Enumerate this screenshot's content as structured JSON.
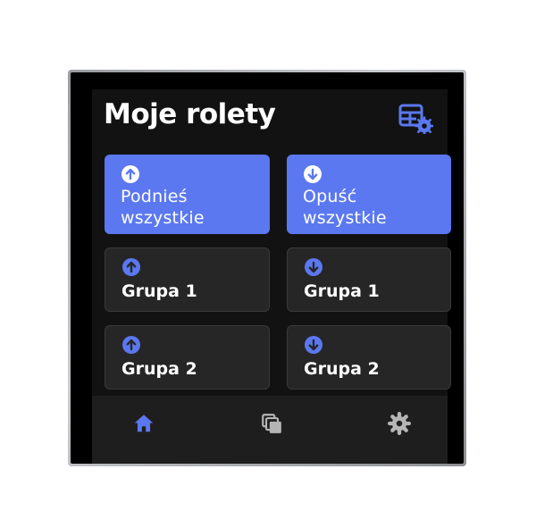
{
  "header": {
    "title": "Moje rolety",
    "settings_icon": "grid-settings-icon"
  },
  "colors": {
    "accent": "#5b78f0",
    "screen_background": "#121212",
    "tile_background": "#262626",
    "nav_background": "#1e1e1e",
    "inactive_icon": "#b5b5b5"
  },
  "tiles": [
    {
      "label_line1": "Podnieś",
      "label_line2": "wszystkie",
      "icon": "arrow-up-circle-icon",
      "style": "primary"
    },
    {
      "label_line1": "Opuść",
      "label_line2": "wszystkie",
      "icon": "arrow-down-circle-icon",
      "style": "primary"
    },
    {
      "label": "Grupa 1",
      "icon": "arrow-up-circle-icon",
      "style": "secondary"
    },
    {
      "label": "Grupa 1",
      "icon": "arrow-down-circle-icon",
      "style": "secondary"
    },
    {
      "label": "Grupa 2",
      "icon": "arrow-up-circle-icon",
      "style": "secondary"
    },
    {
      "label": "Grupa 2",
      "icon": "arrow-down-circle-icon",
      "style": "secondary"
    }
  ],
  "nav": {
    "items": [
      {
        "icon": "home-icon",
        "active": true
      },
      {
        "icon": "layers-icon",
        "active": false
      },
      {
        "icon": "gear-icon",
        "active": false
      }
    ]
  }
}
